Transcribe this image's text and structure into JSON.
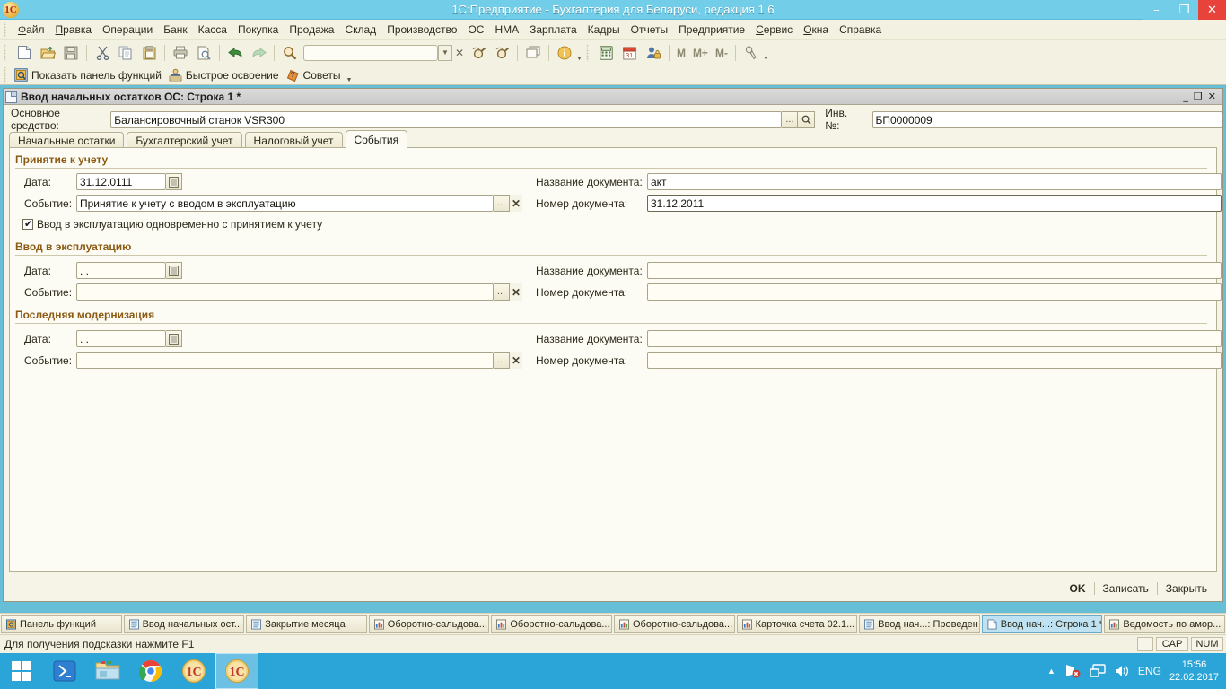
{
  "window": {
    "title": "1С:Предприятие - Бухгалтерия для Беларуси, редакция 1.6",
    "app_icon": "1c-icon",
    "minimize": "–",
    "maximize": "❐",
    "close": "✕"
  },
  "menubar": {
    "items": [
      {
        "label": "Файл",
        "accel": "Ф"
      },
      {
        "label": "Правка",
        "accel": "П"
      },
      {
        "label": "Операции",
        "accel": ""
      },
      {
        "label": "Банк",
        "accel": ""
      },
      {
        "label": "Касса",
        "accel": ""
      },
      {
        "label": "Покупка",
        "accel": ""
      },
      {
        "label": "Продажа",
        "accel": ""
      },
      {
        "label": "Склад",
        "accel": ""
      },
      {
        "label": "Производство",
        "accel": ""
      },
      {
        "label": "ОС",
        "accel": ""
      },
      {
        "label": "НМА",
        "accel": ""
      },
      {
        "label": "Зарплата",
        "accel": ""
      },
      {
        "label": "Кадры",
        "accel": ""
      },
      {
        "label": "Отчеты",
        "accel": ""
      },
      {
        "label": "Предприятие",
        "accel": ""
      },
      {
        "label": "Сервис",
        "accel": "С"
      },
      {
        "label": "Окна",
        "accel": "О"
      },
      {
        "label": "Справка",
        "accel": ""
      }
    ]
  },
  "toolbar_main": {
    "search_value": "",
    "search_placeholder": "",
    "memory": {
      "m": "M",
      "mplus": "M+",
      "mminus": "M-"
    },
    "icons": [
      "new-document-icon",
      "open-folder-icon",
      "save-icon",
      "cut-scissors-icon",
      "copy-icon",
      "paste-icon",
      "print-icon",
      "print-preview-icon",
      "undo-arrow-icon",
      "redo-arrow-icon",
      "find-magnifier-icon"
    ],
    "icons_right": [
      "find-next-icon",
      "find-prev-icon",
      "windows-cascade-icon",
      "info-icon",
      "calculator-icon",
      "calendar-icon",
      "user-lock-icon",
      "wrench-settings-icon"
    ]
  },
  "toolbar_functions": {
    "items": [
      {
        "label": "Показать панель функций",
        "icon": "function-panel-icon"
      },
      {
        "label": "Быстрое освоение",
        "icon": "teacher-icon"
      },
      {
        "label": "Советы",
        "icon": "tips-icon"
      }
    ]
  },
  "document": {
    "title": "Ввод начальных остатков ОС: Строка 1 *",
    "icon": "document-page-icon",
    "minimize": "_",
    "restore": "❐",
    "close": "✕",
    "fixed_asset": {
      "label": "Основное средство:",
      "value": "Балансировочный станок VSR300",
      "pick_button": "...",
      "search_button": "search-icon"
    },
    "inventory_number": {
      "label": "Инв. №:",
      "value": "БП0000009"
    },
    "tabs": [
      {
        "label": "Начальные остатки",
        "active": false
      },
      {
        "label": "Бухгалтерский учет",
        "active": false
      },
      {
        "label": "Налоговый учет",
        "active": false
      },
      {
        "label": "События",
        "active": true
      }
    ],
    "groups": [
      {
        "title": "Принятие к учету",
        "date_label": "Дата:",
        "date_value": "31.12.0111",
        "event_label": "Событие:",
        "event_value": "Принятие к учету с вводом в эксплуатацию",
        "doc_name_label": "Название документа:",
        "doc_name_value": "акт",
        "doc_num_label": "Номер документа:",
        "doc_num_value": "31.12.2011"
      },
      {
        "title": "Ввод в эксплуатацию",
        "date_label": "Дата:",
        "date_value": "  .  .",
        "event_label": "Событие:",
        "event_value": "",
        "doc_name_label": "Название документа:",
        "doc_name_value": "",
        "doc_num_label": "Номер документа:",
        "doc_num_value": ""
      },
      {
        "title": "Последняя модернизация",
        "date_label": "Дата:",
        "date_value": "  .  .",
        "event_label": "Событие:",
        "event_value": "",
        "doc_name_label": "Название документа:",
        "doc_name_value": "",
        "doc_num_label": "Номер документа:",
        "doc_num_value": ""
      }
    ],
    "checkbox": {
      "label": "Ввод в эксплуатацию одновременно с принятием к учету",
      "checked": true
    },
    "footer_buttons": {
      "ok": "OK",
      "write": "Записать",
      "close": "Закрыть"
    }
  },
  "window_tabs": [
    {
      "label": "Панель функций",
      "icon": "function-panel-icon",
      "active": false
    },
    {
      "label": "Ввод начальных ост...",
      "icon": "list-icon",
      "active": false
    },
    {
      "label": "Закрытие месяца",
      "icon": "list-icon",
      "active": false
    },
    {
      "label": "Оборотно-сальдова...",
      "icon": "report-icon",
      "active": false
    },
    {
      "label": "Оборотно-сальдова...",
      "icon": "report-icon",
      "active": false
    },
    {
      "label": "Оборотно-сальдова...",
      "icon": "report-icon",
      "active": false
    },
    {
      "label": "Карточка счета 02.1...",
      "icon": "report-icon",
      "active": false
    },
    {
      "label": "Ввод нач...: Проведен",
      "icon": "list-icon",
      "active": false
    },
    {
      "label": "Ввод нач...: Строка 1 *",
      "icon": "document-page-icon",
      "active": true
    },
    {
      "label": "Ведомость по амор...",
      "icon": "report-icon",
      "active": false
    }
  ],
  "statusbar": {
    "hint": "Для получения подсказки нажмите F1",
    "indicators": [
      "CAP",
      "NUM"
    ]
  },
  "os_taskbar": {
    "start_icon": "windows-logo-icon",
    "apps": [
      {
        "icon": "powershell-icon",
        "active": false
      },
      {
        "icon": "file-explorer-icon",
        "active": false
      },
      {
        "icon": "chrome-icon",
        "active": false
      },
      {
        "icon": "1c-icon",
        "active": false
      },
      {
        "icon": "1c-icon",
        "active": true
      }
    ],
    "tray": {
      "expand_icon": "chevron-up-icon",
      "network_icon": "network-error-icon",
      "monitor_icon": "remote-desktop-icon",
      "volume_icon": "speaker-icon",
      "language": "ENG",
      "time": "15:56",
      "date": "22.02.2017"
    }
  },
  "colors": {
    "title_bar": "#72cde8",
    "close_button": "#e8433a",
    "toolbar_bg": "#f3f1e2",
    "mdi_bg": "#66bfd6",
    "group_title": "#8a5a12",
    "taskbar": "#2ba5d8",
    "active_tab": "#bfe2f2"
  }
}
